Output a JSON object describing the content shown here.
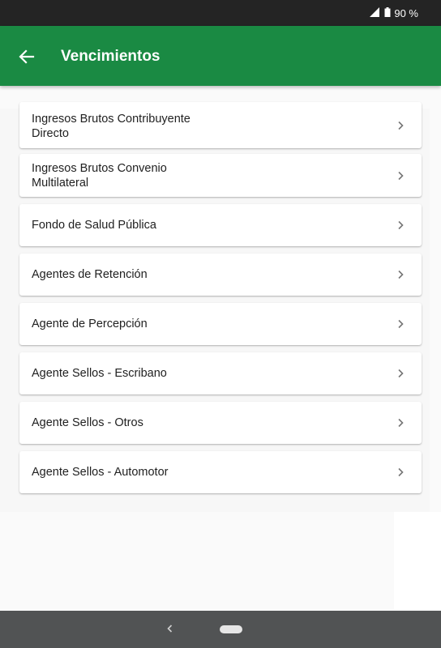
{
  "status_bar": {
    "battery_text": "90 %"
  },
  "app_bar": {
    "title": "Vencimientos"
  },
  "items": [
    {
      "label": "Ingresos Brutos Contribuyente Directo"
    },
    {
      "label": "Ingresos Brutos Convenio Multilateral"
    },
    {
      "label": "Fondo de Salud Pública"
    },
    {
      "label": "Agentes de Retención"
    },
    {
      "label": "Agente de Percepción"
    },
    {
      "label": "Agente Sellos - Escribano"
    },
    {
      "label": "Agente Sellos - Otros"
    },
    {
      "label": "Agente Sellos - Automotor"
    }
  ],
  "colors": {
    "app_bar": "#1a8a43",
    "status_bar": "#242424",
    "nav_bar": "#515354"
  }
}
